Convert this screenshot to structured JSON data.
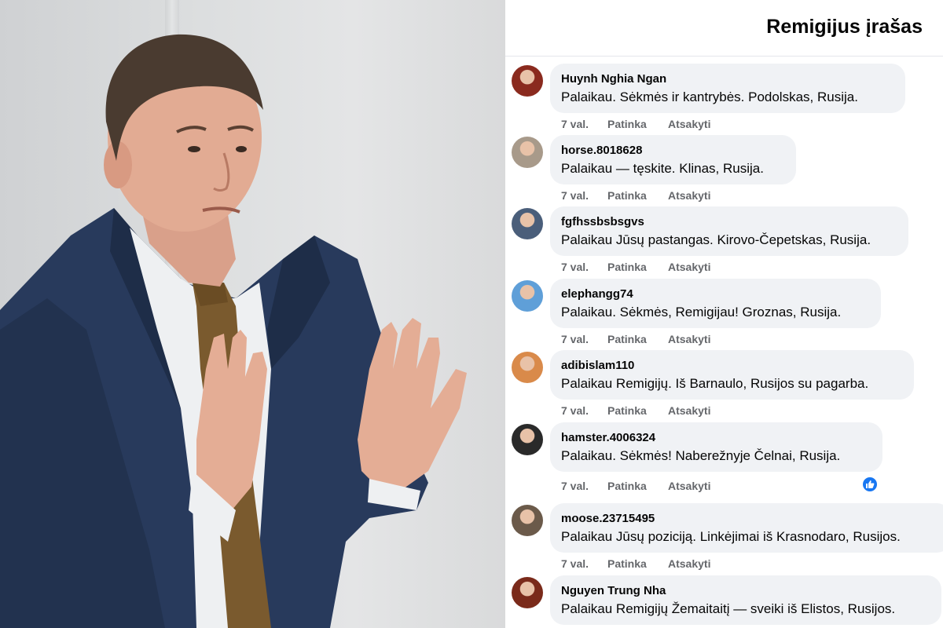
{
  "panel": {
    "title": "Remigijus įrašas"
  },
  "comments": [
    {
      "author": "Huynh Nghia Ngan",
      "text": "Palaikau. Sėkmės ir kantrybės. Podolskas, Rusija.",
      "time": "7 val.",
      "like_label": "Patinka",
      "reply_label": "Atsakyti",
      "avatar_color": "#8a2a1e"
    },
    {
      "author": "horse.8018628",
      "text": "Palaikau — tęskite. Klinas, Rusija.",
      "time": "7 val.",
      "like_label": "Patinka",
      "reply_label": "Atsakyti",
      "avatar_color": "#a89a8a"
    },
    {
      "author": "fgfhssbsbsgvs",
      "text": "Palaikau Jūsų pastangas. Kirovo-Čepetskas, Rusija.",
      "time": "7 val.",
      "like_label": "Patinka",
      "reply_label": "Atsakyti",
      "avatar_color": "#4a5e7a"
    },
    {
      "author": "elephangg74",
      "text": "Palaikau. Sėkmės, Remigijau! Groznas, Rusija.",
      "time": "7 val.",
      "like_label": "Patinka",
      "reply_label": "Atsakyti",
      "avatar_color": "#5f9fd8"
    },
    {
      "author": "adibislam110",
      "text": "Palaikau Remigijų. Iš Barnaulo, Rusijos su pagarba.",
      "time": "7 val.",
      "like_label": "Patinka",
      "reply_label": "Atsakyti",
      "avatar_color": "#d98a4a"
    },
    {
      "author": "hamster.4006324",
      "text": "Palaikau. Sėkmės! Naberežnyje Čelnai, Rusija.",
      "time": "7 val.",
      "like_label": "Patinka",
      "reply_label": "Atsakyti",
      "avatar_color": "#2a2a2a",
      "liked": true
    },
    {
      "author": "moose.23715495",
      "text": "Palaikau Jūsų poziciją. Linkėjimai iš Krasnodaro, Rusijos.",
      "time": "7 val.",
      "like_label": "Patinka",
      "reply_label": "Atsakyti",
      "avatar_color": "#6b5a4a"
    },
    {
      "author": "Nguyen Trung Nha",
      "text": "Palaikau Remigijų Žemaitaitį — sveiki iš Elistos, Rusijos.",
      "time": "",
      "like_label": "",
      "reply_label": "",
      "avatar_color": "#7a2a1a"
    }
  ],
  "icons": {
    "like_reaction": "thumbs-up-icon"
  },
  "colors": {
    "bubble": "#f0f2f5",
    "secondary_text": "#65676b",
    "like_blue": "#1877f2"
  }
}
